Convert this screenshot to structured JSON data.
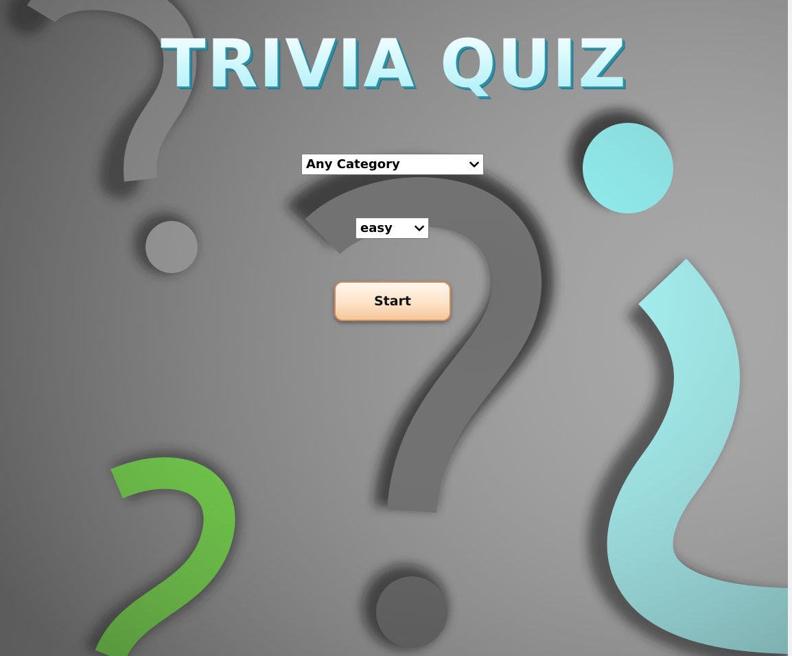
{
  "page": {
    "title": "TRIVIA QUIZ"
  },
  "category_select": {
    "selected": "Any Category",
    "icon": "chevron-down-icon"
  },
  "difficulty_select": {
    "selected": "easy",
    "icon": "chevron-down-icon"
  },
  "start_button": {
    "label": "Start"
  },
  "colors": {
    "title_fill": "#c6f6fb",
    "title_shadow": "#2f8fa6",
    "button_border": "#d0895a",
    "button_fill": "#fde3c8",
    "accent_cyan": "#8ff5f6",
    "accent_green": "#6ddc3d",
    "background_gray": "#8a8a8a"
  }
}
